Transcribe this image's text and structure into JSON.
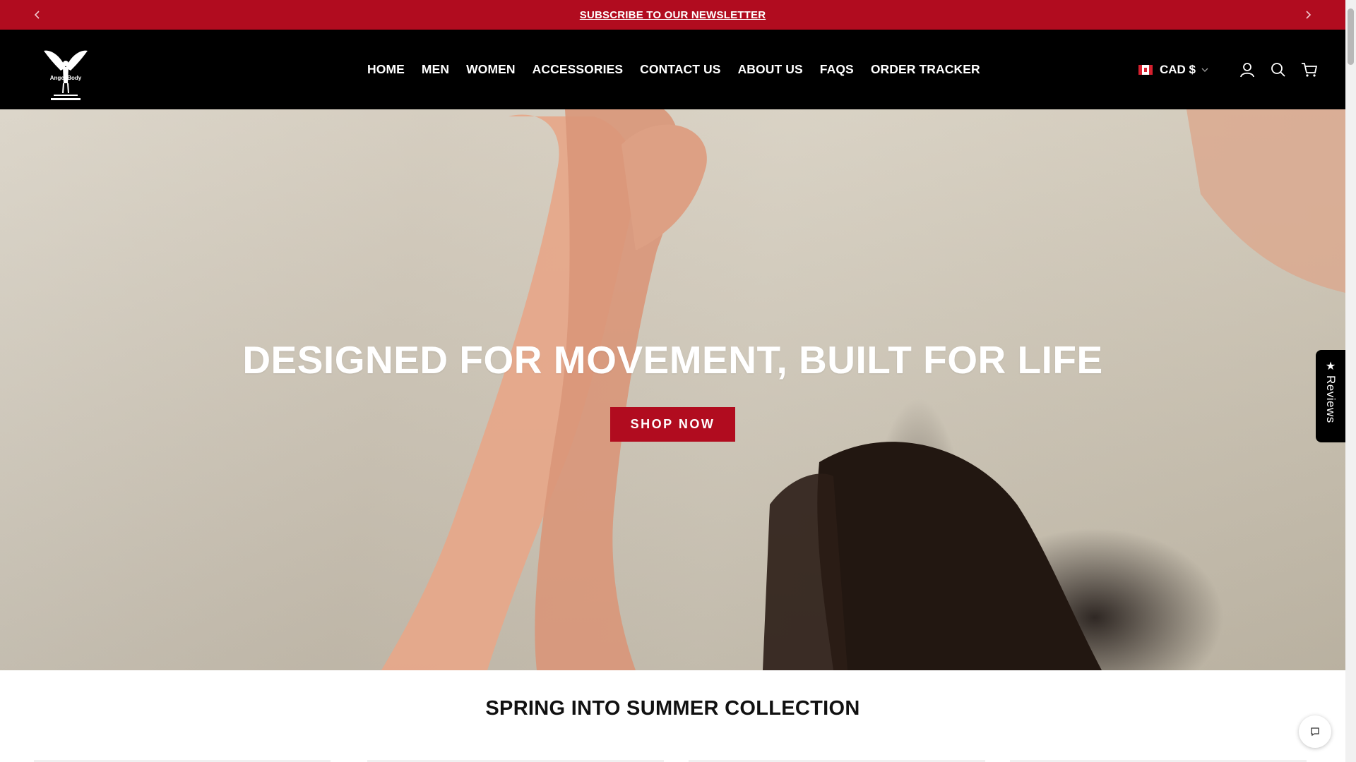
{
  "announcement": {
    "text": "SUBSCRIBE TO OUR NEWSLETTER",
    "prev_icon": "chevron-left-icon",
    "next_icon": "chevron-right-icon"
  },
  "header": {
    "logo_text": "Angel Body",
    "nav": [
      {
        "label": "HOME"
      },
      {
        "label": "MEN"
      },
      {
        "label": "WOMEN"
      },
      {
        "label": "ACCESSORIES"
      },
      {
        "label": "CONTACT US"
      },
      {
        "label": "ABOUT US"
      },
      {
        "label": "FAQS"
      },
      {
        "label": "ORDER TRACKER"
      }
    ],
    "currency": "CAD $",
    "icons": [
      "user-icon",
      "search-icon",
      "cart-icon"
    ]
  },
  "hero": {
    "title": "DESIGNED FOR MOVEMENT, BUILT FOR LIFE",
    "button": "SHOP NOW"
  },
  "reviews_tab": {
    "label": "Reviews",
    "icon": "star-icon"
  },
  "section": {
    "title": "SPRING INTO SUMMER COLLECTION"
  },
  "colors": {
    "accent": "#b10c1f",
    "header_bg": "#000000"
  }
}
